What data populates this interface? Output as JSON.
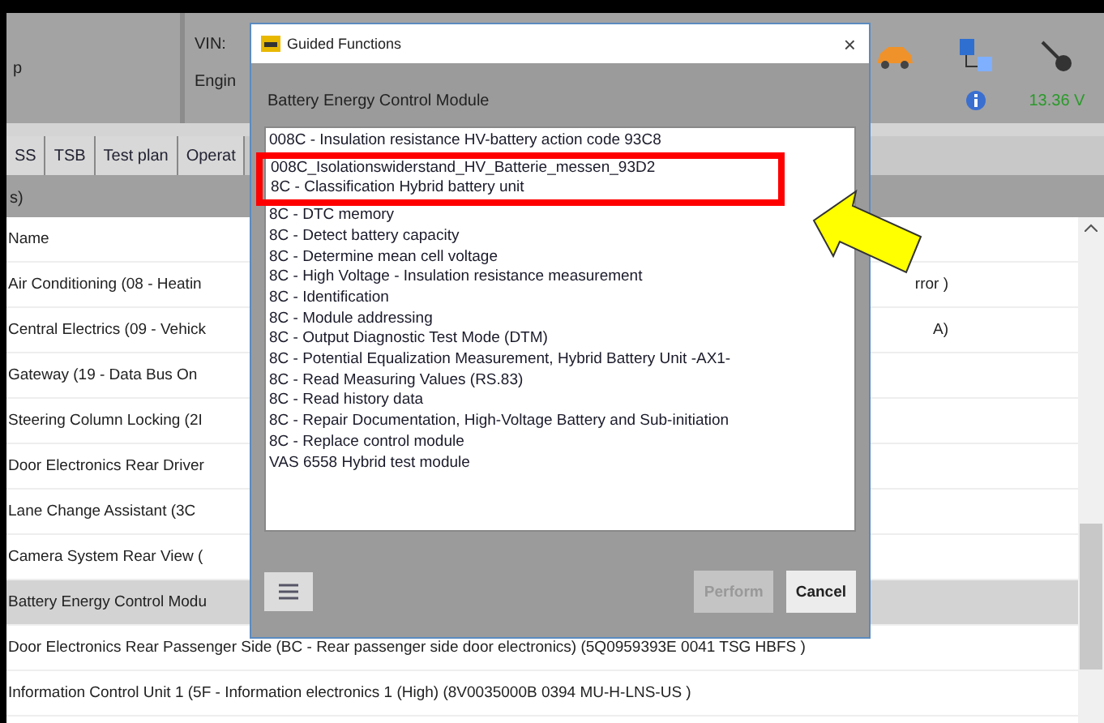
{
  "header": {
    "title_fragment": "p",
    "vin_label": "VIN:",
    "engine_label": "Engin",
    "voltage": "13.36 V"
  },
  "tabs": [
    {
      "label": "SS",
      "selected": false
    },
    {
      "label": "TSB",
      "selected": false
    },
    {
      "label": "Test plan",
      "selected": false
    },
    {
      "label": "Operat",
      "selected": false
    }
  ],
  "section_label": "s)",
  "table": {
    "header": "Name",
    "rows": [
      {
        "name": "Air Conditioning (08 - Heatin",
        "tail": "rror )",
        "selected": false
      },
      {
        "name": "Central Electrics (09 - Vehick",
        "tail": "A)",
        "selected": false
      },
      {
        "name": "Gateway (19 - Data Bus On",
        "selected": false
      },
      {
        "name": "Steering Column Locking (2I",
        "selected": false
      },
      {
        "name": "Door Electronics Rear Driver",
        "selected": false
      },
      {
        "name": "Lane Change Assistant (3C",
        "selected": false
      },
      {
        "name": "Camera System Rear View (",
        "selected": false
      },
      {
        "name": "Battery Energy Control Modu",
        "selected": true
      },
      {
        "name": "Door Electronics Rear Passenger Side (BC - Rear passenger side door electronics) (5Q0959393E    0041    TSG HBFS    )",
        "selected": false
      },
      {
        "name": "Information Control Unit 1 (5F - Information electronics 1 (High) (8V0035000B    0394    MU-H-LNS-US  )",
        "selected": false
      }
    ]
  },
  "dialog": {
    "title": "Guided Functions",
    "close": "×",
    "module": "Battery Energy Control Module",
    "items": [
      {
        "label": "008C - Insulation resistance HV-battery action code 93C8",
        "highlighted": false
      },
      {
        "label": "008C_Isolationswiderstand_HV_Batterie_messen_93D2",
        "highlighted": true
      },
      {
        "label": "8C - Classification Hybrid battery unit",
        "highlighted": true
      },
      {
        "label": "8C - DTC memory",
        "highlighted": false
      },
      {
        "label": "8C - Detect battery capacity",
        "highlighted": false
      },
      {
        "label": "8C - Determine mean cell voltage",
        "highlighted": false
      },
      {
        "label": "8C - High Voltage - Insulation resistance measurement",
        "highlighted": false
      },
      {
        "label": "8C - Identification",
        "highlighted": false
      },
      {
        "label": "8C - Module addressing",
        "highlighted": false
      },
      {
        "label": "8C - Output Diagnostic Test Mode (DTM)",
        "highlighted": false
      },
      {
        "label": "8C - Potential Equalization Measurement, Hybrid Battery Unit -AX1-",
        "highlighted": false
      },
      {
        "label": "8C - Read Measuring Values (RS.83)",
        "highlighted": false
      },
      {
        "label": "8C - Read history data",
        "highlighted": false
      },
      {
        "label": "8C - Repair Documentation, High-Voltage Battery and Sub-initiation",
        "highlighted": false
      },
      {
        "label": "8C - Replace control module",
        "highlighted": false
      },
      {
        "label": "VAS 6558 Hybrid test module",
        "highlighted": false
      }
    ],
    "buttons": [
      {
        "label": "Perform",
        "disabled": true
      },
      {
        "label": "Cancel",
        "disabled": false
      }
    ]
  }
}
